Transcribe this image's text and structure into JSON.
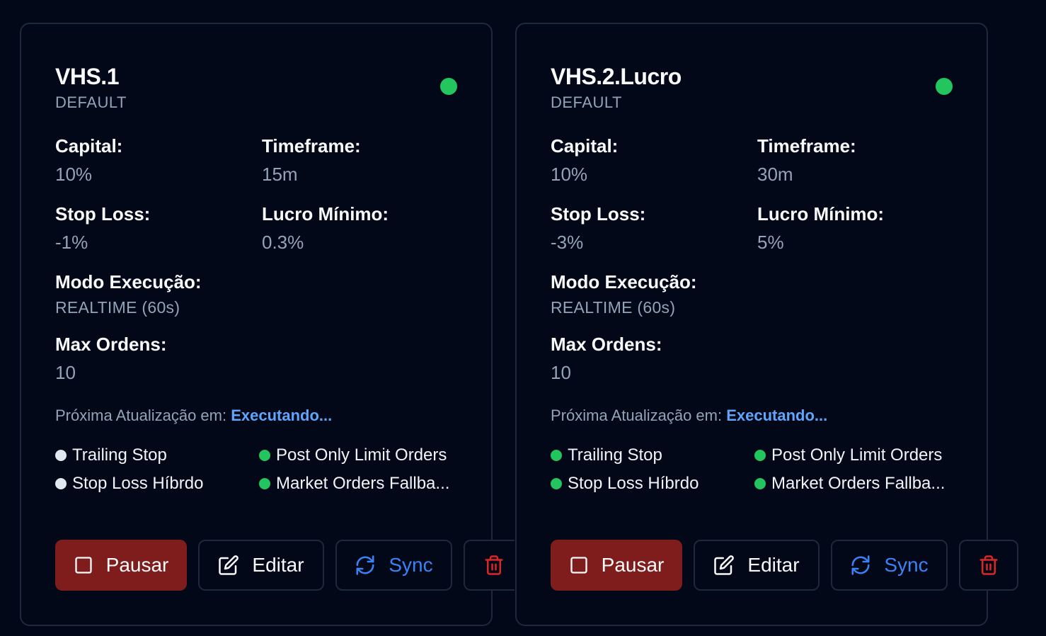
{
  "colors": {
    "background": "#020817",
    "card_border": "#1e293b",
    "status_active": "#22c55e",
    "feature_inactive": "#e2e8f0",
    "link_blue": "#60a5fa",
    "pause_bg": "#7f1d1d",
    "delete_red": "#dc2626",
    "sync_blue": "#3b82f6"
  },
  "labels": {
    "capital": "Capital:",
    "timeframe": "Timeframe:",
    "stop_loss": "Stop Loss:",
    "min_profit": "Lucro Mínimo:",
    "exec_mode": "Modo Execução:",
    "max_orders": "Max Ordens:",
    "next_update": "Próxima Atualização em:"
  },
  "buttons": {
    "pause": "Pausar",
    "edit": "Editar",
    "sync": "Sync"
  },
  "bots": [
    {
      "name": "VHS.1",
      "profile": "DEFAULT",
      "status": "active",
      "capital": "10%",
      "timeframe": "15m",
      "stop_loss": "-1%",
      "min_profit": "0.3%",
      "exec_mode": "REALTIME (60s)",
      "max_orders": "10",
      "next_update_status": "Executando...",
      "features": [
        {
          "label": "Trailing Stop",
          "enabled": false
        },
        {
          "label": "Post Only Limit Orders",
          "enabled": true
        },
        {
          "label": "Stop Loss Híbrdo",
          "enabled": false
        },
        {
          "label": "Market Orders Fallba...",
          "enabled": true
        }
      ]
    },
    {
      "name": "VHS.2.Lucro",
      "profile": "DEFAULT",
      "status": "active",
      "capital": "10%",
      "timeframe": "30m",
      "stop_loss": "-3%",
      "min_profit": "5%",
      "exec_mode": "REALTIME (60s)",
      "max_orders": "10",
      "next_update_status": "Executando...",
      "features": [
        {
          "label": "Trailing Stop",
          "enabled": true
        },
        {
          "label": "Post Only Limit Orders",
          "enabled": true
        },
        {
          "label": "Stop Loss Híbrdo",
          "enabled": true
        },
        {
          "label": "Market Orders Fallba...",
          "enabled": true
        }
      ]
    }
  ]
}
